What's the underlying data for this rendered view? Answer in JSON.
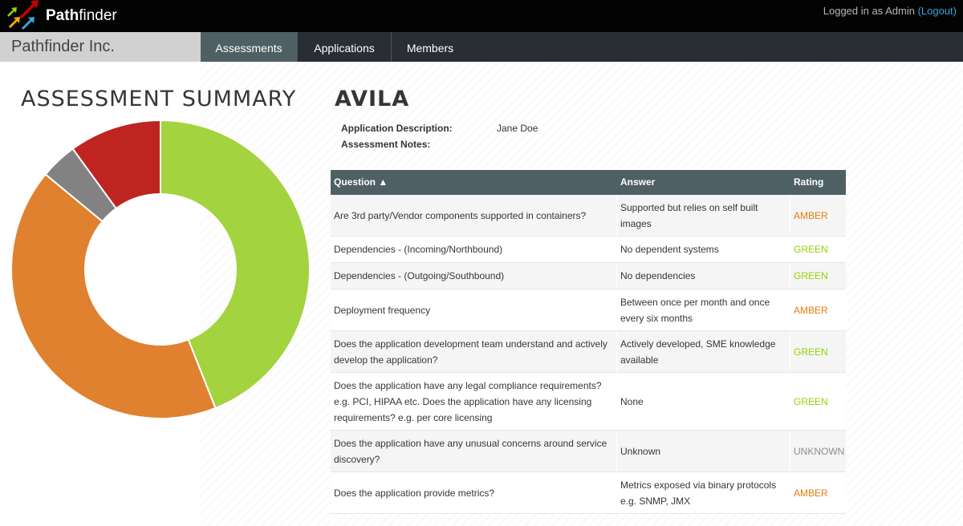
{
  "header": {
    "brand_bold": "Path",
    "brand_rest": "finder",
    "login_text": "Logged in as Admin ",
    "logout_label": "(Logout)"
  },
  "nav": {
    "org_name": "Pathfinder Inc.",
    "tabs": [
      {
        "label": "Assessments",
        "active": true
      },
      {
        "label": "Applications",
        "active": false
      },
      {
        "label": "Members",
        "active": false
      }
    ]
  },
  "summary": {
    "title": "ASSESSMENT SUMMARY"
  },
  "chart_data": {
    "type": "pie",
    "title": "ASSESSMENT SUMMARY",
    "categories": [
      "GREEN",
      "AMBER",
      "UNKNOWN",
      "RED"
    ],
    "values": [
      44,
      42,
      4,
      10
    ],
    "colors": [
      "#a3d33f",
      "#e0812f",
      "#828282",
      "#be2520"
    ],
    "donut": true
  },
  "application": {
    "name": "AVILA",
    "description_label": "Application Description:",
    "description_value": "Jane Doe",
    "notes_label": "Assessment Notes:"
  },
  "table": {
    "headers": {
      "question": "Question ▲",
      "answer": "Answer",
      "rating": "Rating"
    },
    "rows": [
      {
        "question": "Are 3rd party/Vendor components supported in containers?",
        "answer": "Supported but relies on self built images",
        "rating": "AMBER"
      },
      {
        "question": "Dependencies - (Incoming/Northbound)",
        "answer": "No dependent systems",
        "rating": "GREEN"
      },
      {
        "question": "Dependencies - (Outgoing/Southbound)",
        "answer": "No dependencies",
        "rating": "GREEN"
      },
      {
        "question": "Deployment frequency",
        "answer": "Between once per month and once every six months",
        "rating": "AMBER"
      },
      {
        "question": "Does the application development team understand and actively develop the application?",
        "answer": "Actively developed, SME knowledge available",
        "rating": "GREEN"
      },
      {
        "question": "Does the application have any legal compliance requirements? e.g. PCI, HIPAA etc. Does the application have any licensing requirements? e.g. per core licensing",
        "answer": "None",
        "rating": "GREEN"
      },
      {
        "question": "Does the application have any unusual concerns around service discovery?",
        "answer": "Unknown",
        "rating": "UNKNOWN"
      },
      {
        "question": "Does the application provide metrics?",
        "answer": "Metrics exposed via binary protocols e.g. SNMP, JMX",
        "rating": "AMBER"
      }
    ]
  }
}
